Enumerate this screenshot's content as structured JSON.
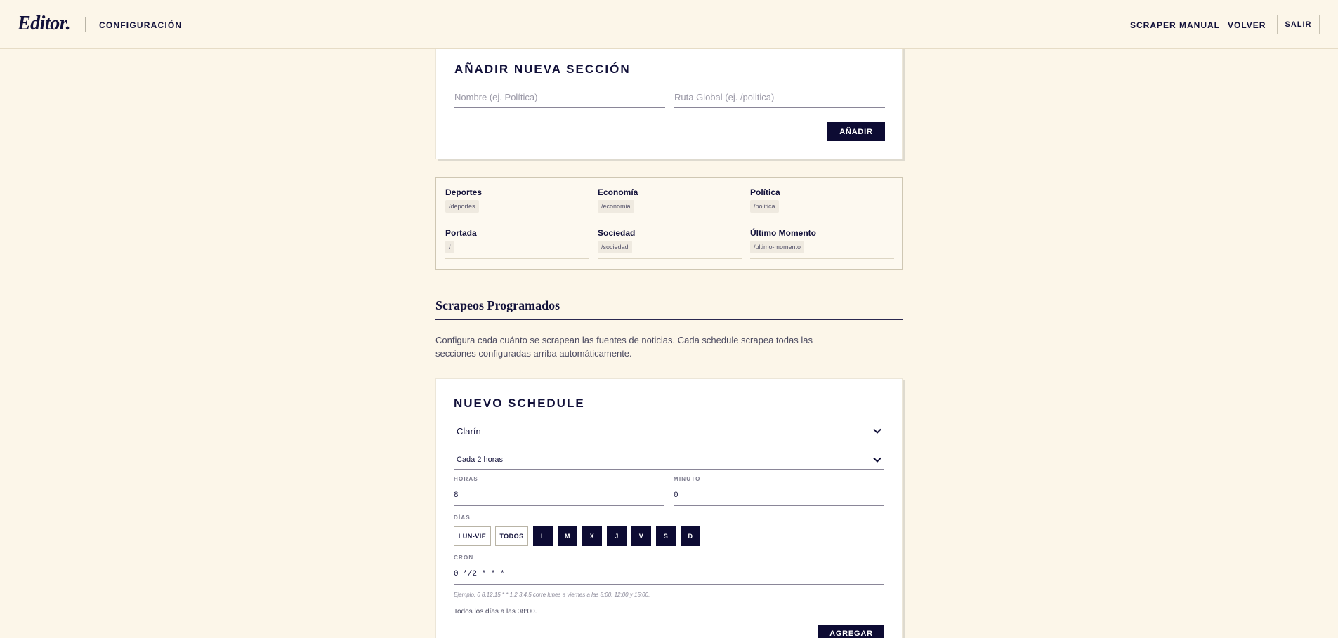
{
  "header": {
    "logo": "Editor.",
    "title": "CONFIGURACIÓN",
    "nav": {
      "scraper_manual": "SCRAPER MANUAL",
      "volver": "VOLVER",
      "salir": "SALIR"
    }
  },
  "new_section": {
    "title": "AÑADIR NUEVA SECCIÓN",
    "name_placeholder": "Nombre (ej. Política)",
    "route_placeholder": "Ruta Global (ej. /politica)",
    "add_button": "AÑADIR"
  },
  "sections": [
    {
      "name": "Deportes",
      "route": "/deportes"
    },
    {
      "name": "Economía",
      "route": "/economia"
    },
    {
      "name": "Política",
      "route": "/politica"
    },
    {
      "name": "Portada",
      "route": "/"
    },
    {
      "name": "Sociedad",
      "route": "/sociedad"
    },
    {
      "name": "Último Momento",
      "route": "/ultimo-momento"
    }
  ],
  "scheduled": {
    "title": "Scrapeos Programados",
    "description": "Configura cada cuánto se scrapean las fuentes de noticias. Cada schedule scrapea todas las secciones configuradas arriba automáticamente."
  },
  "new_schedule": {
    "title": "NUEVO SCHEDULE",
    "source_selected": "Clarín",
    "frequency_selected": "Cada 2 horas",
    "hours_label": "HORAS",
    "hours_value": "8",
    "minute_label": "MINUTO",
    "minute_value": "0",
    "days_label": "DÍAS",
    "day_presets": [
      "LUN-VIE",
      "TODOS"
    ],
    "days": [
      "L",
      "M",
      "X",
      "J",
      "V",
      "S",
      "D"
    ],
    "cron_label": "CRON",
    "cron_value": "0 */2 * * *",
    "cron_hint": "Ejemplo: 0 8,12,15 * * 1,2,3,4,5 corre lunes a viernes a las 8:00, 12:00 y 15:00.",
    "summary": "Todos los días a las 08:00.",
    "add_button": "AGREGAR"
  },
  "colors": {
    "background": "#fcf6e9",
    "accent": "#0d0b33",
    "card": "#ffffff"
  }
}
